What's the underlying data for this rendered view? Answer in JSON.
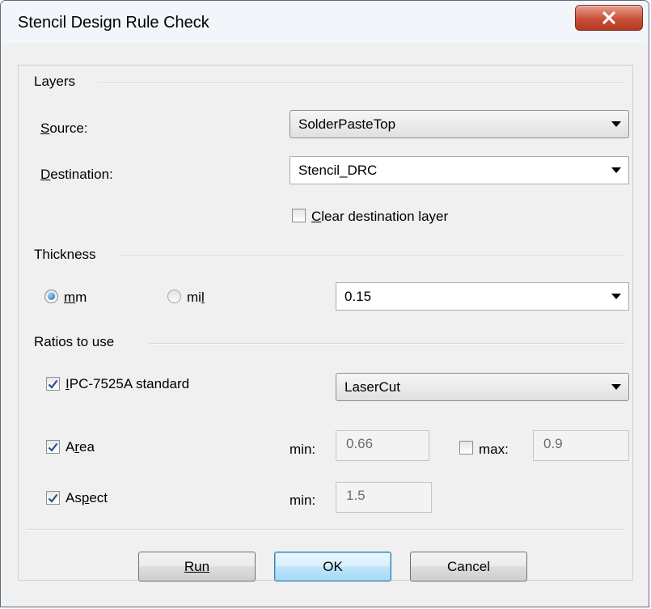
{
  "window": {
    "title": "Stencil Design Rule Check",
    "close_icon": "close-x-icon"
  },
  "layers": {
    "group_label": "Layers",
    "source_label": "Source:",
    "source_value": "SolderPasteTop",
    "destination_label": "Destination:",
    "destination_value": "Stencil_DRC",
    "clear_destination_label": "Clear destination layer",
    "clear_destination_checked": false
  },
  "thickness": {
    "group_label": "Thickness",
    "unit_mm_label": "mm",
    "unit_mil_label": "mil",
    "selected_unit": "mm",
    "value": "0.15"
  },
  "ratios": {
    "group_label": "Ratios to use",
    "ipc_label": "IPC-7525A standard",
    "ipc_checked": true,
    "ipc_value": "LaserCut",
    "area_label": "Area",
    "area_checked": true,
    "area_min_label": "min:",
    "area_min_value": "0.66",
    "area_max_label": "max:",
    "area_max_checked": false,
    "area_max_value": "0.9",
    "aspect_label": "Aspect",
    "aspect_checked": true,
    "aspect_min_label": "min:",
    "aspect_min_value": "1.5"
  },
  "buttons": {
    "run": "Run",
    "ok": "OK",
    "cancel": "Cancel"
  },
  "colors": {
    "close_button": "#c8503a",
    "default_button_border": "#3c7fb1",
    "radio_selected": "#1e62b8"
  }
}
